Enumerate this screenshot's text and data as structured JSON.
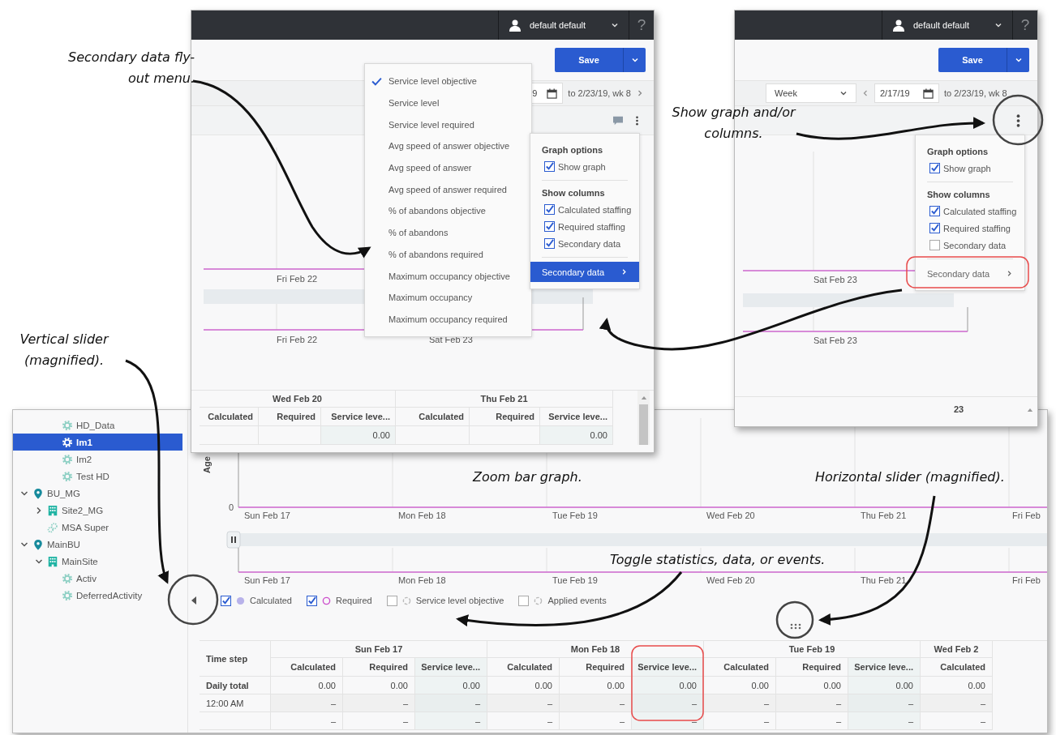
{
  "annotations": [
    "Secondary data fly-out menu.",
    "Show graph and/or columns.",
    "Vertical slider (magnified).",
    "Zoom bar graph.",
    "Horizontal slider (magnified).",
    "Toggle statistics, data, or events."
  ],
  "top_left_view": {
    "user": "default default",
    "help": "?",
    "save": "Save",
    "date_fragment": "9",
    "date_range": "to 2/23/19, wk 8",
    "secondary_menu": [
      {
        "label": "Service level objective",
        "checked": true
      },
      {
        "label": "Service level",
        "checked": false
      },
      {
        "label": "Service level required",
        "checked": false
      },
      {
        "label": "Avg speed of answer objective",
        "checked": false
      },
      {
        "label": "Avg speed of answer",
        "checked": false
      },
      {
        "label": "Avg speed of answer required",
        "checked": false
      },
      {
        "label": "% of abandons objective",
        "checked": false
      },
      {
        "label": "% of abandons",
        "checked": false
      },
      {
        "label": "% of abandons required",
        "checked": false
      },
      {
        "label": "Maximum occupancy objective",
        "checked": false
      },
      {
        "label": "Maximum occupancy",
        "checked": false
      },
      {
        "label": "Maximum occupancy required",
        "checked": false
      }
    ],
    "options_menu": {
      "graph_heading": "Graph options",
      "graph_items": [
        {
          "label": "Show graph",
          "checked": true
        }
      ],
      "columns_heading": "Show columns",
      "column_items": [
        {
          "label": "Calculated staffing",
          "checked": true
        },
        {
          "label": "Required staffing",
          "checked": true
        },
        {
          "label": "Secondary data",
          "checked": true
        }
      ],
      "submenu": {
        "label": "Secondary data",
        "highlighted": true
      }
    },
    "graph_labels": [
      "Fri Feb 22"
    ],
    "zoom_labels": [
      "Fri Feb 22",
      "Sat Feb 23"
    ],
    "table": {
      "days": [
        "Wed Feb 20",
        "Thu Feb 21"
      ],
      "columns": [
        "Calculated",
        "Required",
        "Service leve...",
        "Calculated",
        "Required",
        "Service leve..."
      ],
      "service_values": [
        "0.00",
        "0.00"
      ]
    }
  },
  "top_right_view": {
    "user": "default default",
    "help": "?",
    "save": "Save",
    "period": "Week",
    "date": "2/17/19",
    "date_range": "to 2/23/19, wk 8",
    "options_menu": {
      "graph_heading": "Graph options",
      "graph_items": [
        {
          "label": "Show graph",
          "checked": true
        }
      ],
      "columns_heading": "Show columns",
      "column_items": [
        {
          "label": "Calculated staffing",
          "checked": true
        },
        {
          "label": "Required staffing",
          "checked": true
        },
        {
          "label": "Secondary data",
          "checked": false
        }
      ],
      "submenu": {
        "label": "Secondary data",
        "highlighted": false
      }
    },
    "graph_labels": [
      "Sat Feb 23"
    ],
    "zoom_labels": [
      "Sat Feb 23"
    ],
    "table": {
      "days": [
        "23"
      ]
    }
  },
  "bottom_view": {
    "tree": {
      "continued": [
        {
          "label": "HD_Data",
          "kind": "activity",
          "selected": false
        },
        {
          "label": "Im1",
          "kind": "activity",
          "selected": true
        },
        {
          "label": "Im2",
          "kind": "activity",
          "selected": false
        },
        {
          "label": "Test HD",
          "kind": "activity",
          "selected": false
        }
      ],
      "nodes": [
        {
          "label": "BU_MG",
          "kind": "business-unit",
          "expanded": true,
          "selected": false,
          "children": [
            {
              "label": "Site2_MG",
              "kind": "site",
              "expanded": false,
              "selected": false
            },
            {
              "label": "MSA Super",
              "kind": "multi-site-activity",
              "selected": false
            }
          ]
        },
        {
          "label": "MainBU",
          "kind": "business-unit",
          "expanded": true,
          "selected": false,
          "children": [
            {
              "label": "MainSite",
              "kind": "site",
              "expanded": true,
              "selected": false,
              "children": [
                {
                  "label": "Activ",
                  "kind": "activity",
                  "selected": false
                },
                {
                  "label": "DeferredActivity",
                  "kind": "activity",
                  "selected": false
                }
              ]
            }
          ]
        }
      ]
    },
    "y_axis_label": "Age",
    "y_tick": "0",
    "graph_labels": [
      "Sun Feb 17",
      "Mon Feb 18",
      "Tue Feb 19",
      "Wed Feb 20",
      "Thu Feb 21",
      "Fri Feb"
    ],
    "zoom_labels": [
      "Sun Feb 17",
      "Mon Feb 18",
      "Tue Feb 19",
      "Wed Feb 20",
      "Thu Feb 21",
      "Fri Feb"
    ],
    "legend": [
      {
        "label": "Calculated",
        "checked": true,
        "kind": "dot",
        "color": "#b8b2ea"
      },
      {
        "label": "Required",
        "checked": true,
        "kind": "ring",
        "color": "#cc4fcc"
      },
      {
        "label": "Service level objective",
        "checked": false,
        "kind": "dashed-ring",
        "color": "#bbbbbb"
      },
      {
        "label": "Applied events",
        "checked": false,
        "kind": "dashed-ring",
        "color": "#bbbbbb"
      }
    ],
    "table": {
      "corner": "Time step",
      "days": [
        {
          "label": "Sun Feb 17",
          "columns": [
            "Calculated",
            "Required",
            "Service leve..."
          ]
        },
        {
          "label": "Mon Feb 18",
          "columns": [
            "Calculated",
            "Required",
            "Service leve..."
          ]
        },
        {
          "label": "Tue Feb 19",
          "columns": [
            "Calculated",
            "Required",
            "Service leve..."
          ]
        },
        {
          "label": "Wed Feb 2",
          "columns": [
            "Calculated"
          ]
        }
      ],
      "rows": [
        {
          "label": "Daily total",
          "cells": [
            "0.00",
            "0.00",
            "0.00",
            "0.00",
            "0.00",
            "0.00",
            "0.00",
            "0.00",
            "0.00",
            "0.00"
          ]
        },
        {
          "label": "12:00 AM",
          "cells": [
            "–",
            "–",
            "–",
            "–",
            "–",
            "–",
            "–",
            "–",
            "–",
            "–"
          ]
        },
        {
          "cells": [
            "–",
            "–",
            "–",
            "–",
            "–",
            "–",
            "–",
            "–",
            "–",
            "–"
          ]
        }
      ]
    }
  }
}
